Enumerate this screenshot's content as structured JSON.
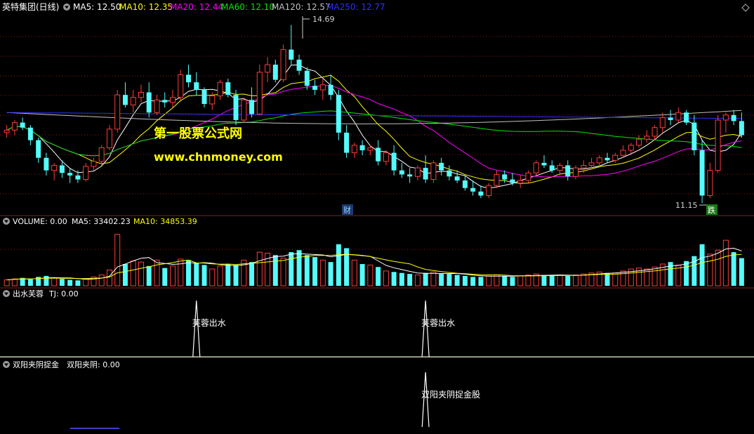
{
  "colors": {
    "bg": "#000000",
    "grid": "#8b1a1a",
    "up": "#ff3c3c",
    "down": "#54fcfc",
    "ma5": "#ffffff",
    "ma10": "#ffff00",
    "ma20": "#ff00ff",
    "ma60": "#00e600",
    "ma120": "#c0c0c0",
    "ma250": "#3030ff",
    "watermark": "#ffff00",
    "finance_flag": "#4aa0ff",
    "drop_flag": "#00c000"
  },
  "price_panel": {
    "stock_name": "英特集团(日线)",
    "indicators": [
      {
        "label": "MA5: 12.50",
        "color": "#ffffff"
      },
      {
        "label": "MA10: 12.35",
        "color": "#ffff00"
      },
      {
        "label": "MA20: 12.44",
        "color": "#ff00ff"
      },
      {
        "label": "MA60: 12.10",
        "color": "#00e600"
      },
      {
        "label": "MA120: 12.57",
        "color": "#c0c0c0"
      },
      {
        "label": "MA250: 12.77",
        "color": "#3030ff"
      }
    ],
    "high_label": "14.69",
    "low_label": "11.15",
    "finance_flag": "财",
    "drop_flag": "跌",
    "watermark_title": "第一股票公式网",
    "watermark_url": "www.chnmoney.com"
  },
  "volume_panel": {
    "name": "VOLUME: 0.00",
    "indicators": [
      {
        "label": "MA5: 33402.23",
        "color": "#ffffff"
      },
      {
        "label": "MA10: 34853.39",
        "color": "#ffff00"
      }
    ]
  },
  "signal_panel_1": {
    "name": "出水芙蓉",
    "value_label": "TJ: 0.00",
    "signal_text": "芙蓉出水"
  },
  "signal_panel_2": {
    "name": "双阳夹阴捉金",
    "value_label": "双阳夹阴: 0.00",
    "signal_text": "双阳夹阴捉金股"
  },
  "chart_data": {
    "type": "candlestick",
    "ohlc": [
      [
        12.55,
        12.7,
        12.45,
        12.6
      ],
      [
        12.6,
        12.8,
        12.5,
        12.75
      ],
      [
        12.75,
        12.85,
        12.6,
        12.65
      ],
      [
        12.65,
        12.7,
        12.3,
        12.4
      ],
      [
        12.4,
        12.45,
        11.95,
        12.05
      ],
      [
        12.05,
        12.15,
        11.7,
        11.8
      ],
      [
        11.8,
        11.95,
        11.6,
        11.9
      ],
      [
        11.9,
        12.0,
        11.65,
        11.75
      ],
      [
        11.75,
        11.85,
        11.55,
        11.7
      ],
      [
        11.7,
        11.8,
        11.55,
        11.62
      ],
      [
        11.62,
        11.95,
        11.58,
        11.88
      ],
      [
        11.88,
        12.05,
        11.8,
        11.98
      ],
      [
        11.98,
        12.3,
        11.9,
        12.25
      ],
      [
        12.25,
        12.7,
        12.2,
        12.62
      ],
      [
        12.62,
        13.4,
        12.55,
        13.3
      ],
      [
        13.3,
        13.55,
        13.05,
        13.1
      ],
      [
        13.1,
        13.4,
        12.95,
        13.25
      ],
      [
        13.25,
        13.5,
        13.15,
        13.35
      ],
      [
        13.35,
        13.55,
        12.85,
        12.95
      ],
      [
        12.95,
        13.3,
        12.9,
        13.2
      ],
      [
        13.2,
        13.35,
        13.05,
        13.15
      ],
      [
        13.15,
        13.4,
        13.05,
        13.25
      ],
      [
        13.25,
        13.8,
        13.2,
        13.7
      ],
      [
        13.7,
        13.9,
        13.45,
        13.55
      ],
      [
        13.55,
        13.75,
        13.3,
        13.4
      ],
      [
        13.4,
        13.45,
        13.05,
        13.12
      ],
      [
        13.12,
        13.35,
        13.0,
        13.28
      ],
      [
        13.28,
        13.6,
        13.2,
        13.55
      ],
      [
        13.55,
        13.62,
        13.25,
        13.3
      ],
      [
        13.3,
        13.4,
        12.7,
        12.8
      ],
      [
        12.8,
        13.25,
        12.75,
        13.2
      ],
      [
        13.2,
        13.45,
        12.85,
        12.92
      ],
      [
        12.92,
        13.9,
        12.9,
        13.75
      ],
      [
        13.75,
        14.05,
        13.55,
        13.9
      ],
      [
        13.9,
        14.0,
        13.55,
        13.6
      ],
      [
        13.6,
        14.3,
        13.55,
        14.2
      ],
      [
        14.2,
        14.69,
        13.9,
        14.0
      ],
      [
        14.0,
        14.1,
        13.7,
        13.78
      ],
      [
        13.78,
        13.85,
        13.4,
        13.48
      ],
      [
        13.48,
        13.6,
        13.3,
        13.4
      ],
      [
        13.4,
        13.62,
        13.2,
        13.5
      ],
      [
        13.5,
        13.7,
        13.2,
        13.3
      ],
      [
        13.3,
        13.4,
        12.4,
        12.55
      ],
      [
        12.55,
        12.7,
        12.05,
        12.15
      ],
      [
        12.15,
        12.35,
        12.05,
        12.3
      ],
      [
        12.3,
        12.4,
        12.1,
        12.2
      ],
      [
        12.2,
        12.3,
        12.1,
        12.25
      ],
      [
        12.25,
        12.4,
        11.9,
        11.98
      ],
      [
        11.98,
        12.2,
        11.9,
        12.15
      ],
      [
        12.15,
        12.3,
        11.7,
        11.8
      ],
      [
        11.8,
        11.95,
        11.65,
        11.72
      ],
      [
        11.72,
        11.85,
        11.55,
        11.68
      ],
      [
        11.68,
        11.9,
        11.6,
        11.85
      ],
      [
        11.85,
        12.1,
        11.55,
        11.62
      ],
      [
        11.62,
        12.0,
        11.55,
        11.95
      ],
      [
        11.95,
        12.05,
        11.7,
        11.8
      ],
      [
        11.8,
        11.9,
        11.6,
        11.68
      ],
      [
        11.68,
        11.8,
        11.55,
        11.6
      ],
      [
        11.6,
        11.7,
        11.4,
        11.45
      ],
      [
        11.45,
        11.6,
        11.3,
        11.38
      ],
      [
        11.38,
        11.5,
        11.25,
        11.3
      ],
      [
        11.3,
        11.55,
        11.25,
        11.5
      ],
      [
        11.5,
        11.8,
        11.45,
        11.72
      ],
      [
        11.72,
        11.8,
        11.55,
        11.62
      ],
      [
        11.62,
        11.75,
        11.5,
        11.55
      ],
      [
        11.55,
        11.7,
        11.45,
        11.6
      ],
      [
        11.6,
        11.8,
        11.55,
        11.75
      ],
      [
        11.75,
        12.0,
        11.7,
        11.95
      ],
      [
        11.95,
        12.1,
        11.85,
        11.9
      ],
      [
        11.9,
        12.0,
        11.75,
        11.8
      ],
      [
        11.8,
        11.95,
        11.7,
        11.9
      ],
      [
        11.9,
        12.0,
        11.6,
        11.68
      ],
      [
        11.68,
        11.9,
        11.62,
        11.85
      ],
      [
        11.85,
        12.0,
        11.75,
        11.9
      ],
      [
        11.9,
        12.05,
        11.85,
        11.95
      ],
      [
        11.95,
        12.1,
        11.85,
        12.05
      ],
      [
        12.05,
        12.15,
        11.95,
        12.0
      ],
      [
        12.0,
        12.15,
        11.95,
        12.1
      ],
      [
        12.1,
        12.3,
        12.05,
        12.2
      ],
      [
        12.2,
        12.35,
        12.1,
        12.3
      ],
      [
        12.3,
        12.5,
        12.25,
        12.42
      ],
      [
        12.42,
        12.6,
        12.35,
        12.48
      ],
      [
        12.48,
        12.7,
        12.4,
        12.65
      ],
      [
        12.65,
        12.95,
        12.55,
        12.85
      ],
      [
        12.85,
        13.0,
        12.7,
        12.8
      ],
      [
        12.8,
        13.05,
        12.75,
        12.95
      ],
      [
        12.95,
        13.0,
        12.7,
        12.75
      ],
      [
        12.75,
        12.9,
        12.1,
        12.2
      ],
      [
        12.2,
        12.4,
        11.15,
        11.3
      ],
      [
        11.3,
        11.95,
        11.25,
        11.8
      ],
      [
        11.8,
        12.9,
        11.75,
        12.8
      ],
      [
        12.8,
        12.95,
        12.55,
        12.9
      ],
      [
        12.9,
        13.0,
        12.7,
        12.78
      ],
      [
        12.78,
        12.95,
        12.45,
        12.5
      ]
    ],
    "volume": [
      6000,
      7000,
      8000,
      6500,
      9000,
      10000,
      8000,
      7000,
      6000,
      5500,
      7000,
      9000,
      11000,
      16000,
      52000,
      22000,
      25000,
      24000,
      20000,
      26000,
      18000,
      20000,
      27000,
      26000,
      23000,
      21000,
      17000,
      20000,
      22000,
      21000,
      26000,
      24000,
      34000,
      33000,
      31000,
      28000,
      34000,
      36000,
      31000,
      29000,
      26000,
      24000,
      42000,
      38000,
      26000,
      22000,
      21000,
      19000,
      15000,
      14000,
      13000,
      12000,
      11000,
      13000,
      14000,
      12000,
      12000,
      11000,
      10000,
      9000,
      9000,
      10000,
      11000,
      10000,
      9000,
      10000,
      11000,
      12000,
      11000,
      10000,
      11000,
      10000,
      11000,
      12000,
      13000,
      14000,
      13000,
      13000,
      15000,
      17000,
      18000,
      17000,
      19000,
      22000,
      24000,
      21000,
      25000,
      30000,
      42000,
      32000,
      36000,
      46000,
      34000,
      28000
    ],
    "signals_1": [
      24,
      53
    ],
    "signals_2": [
      53
    ]
  }
}
